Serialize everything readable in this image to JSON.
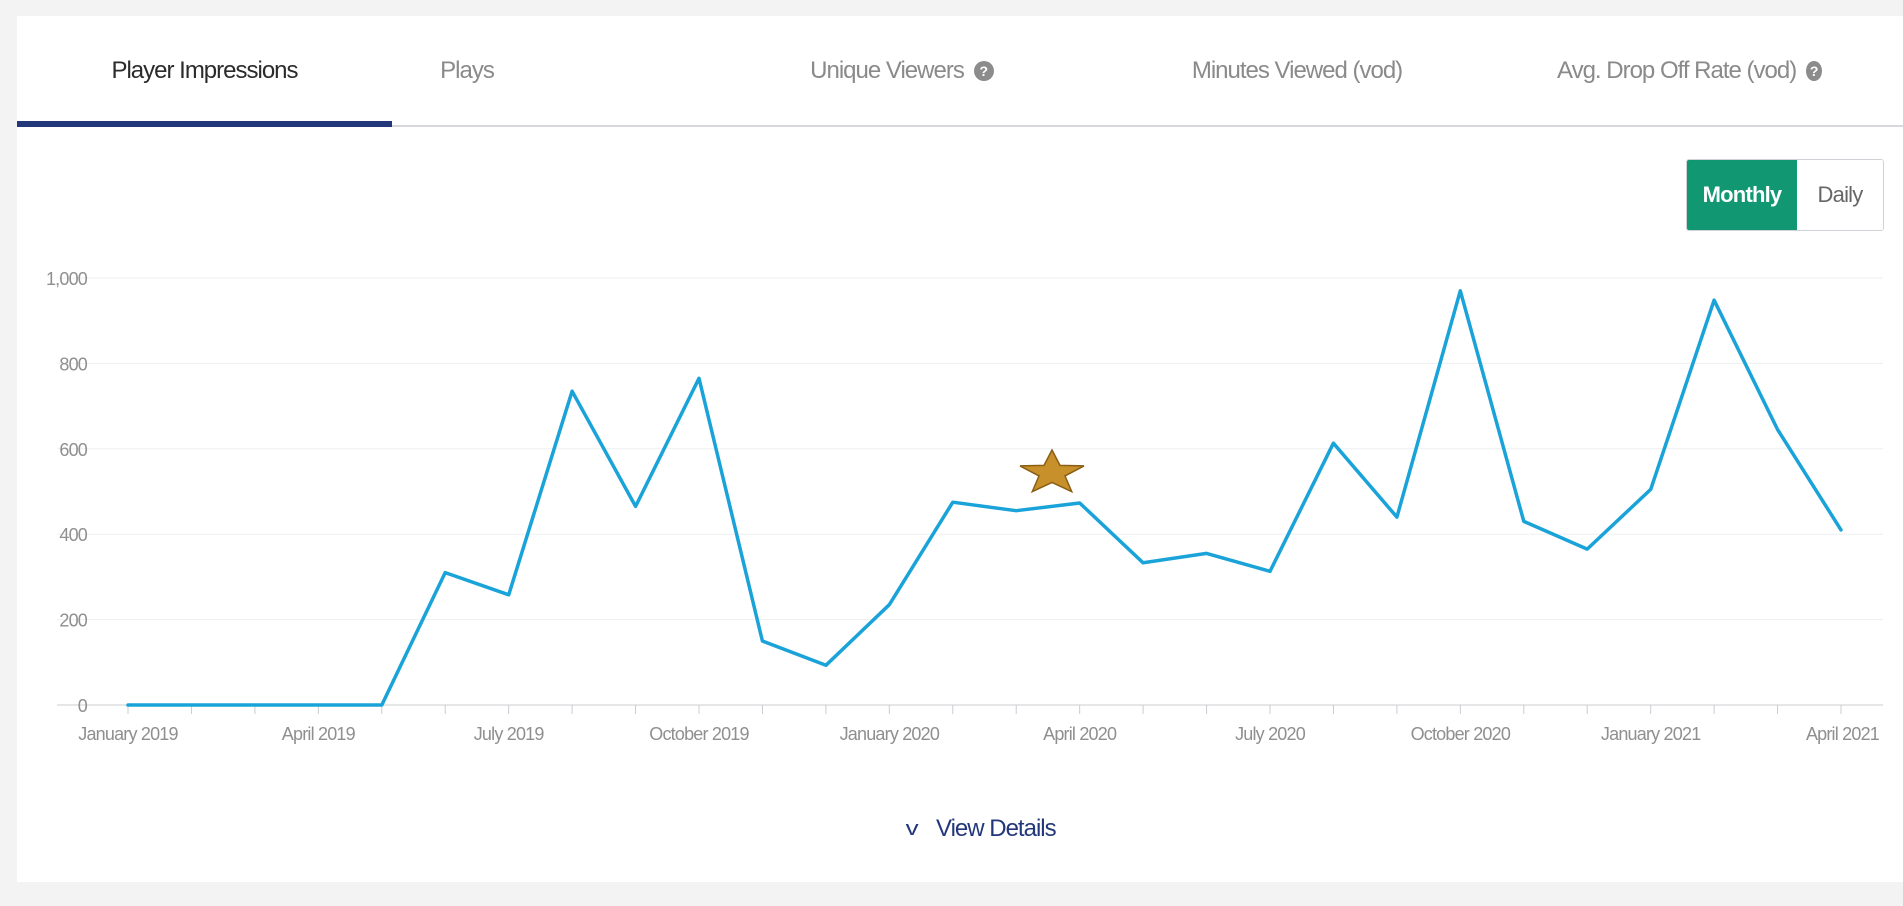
{
  "tabs": [
    {
      "label": "Player Impressions",
      "active": true,
      "help": false
    },
    {
      "label": "Plays",
      "active": false,
      "help": false
    },
    {
      "label": "Unique Viewers",
      "active": false,
      "help": true
    },
    {
      "label": "Minutes Viewed (vod)",
      "active": false,
      "help": false
    },
    {
      "label": "Avg. Drop Off Rate (vod)",
      "active": false,
      "help": true
    }
  ],
  "help_icon_glyph": "?",
  "toggle": {
    "monthly_label": "Monthly",
    "daily_label": "Daily",
    "selected": "Monthly"
  },
  "view_details": {
    "chevron": "v",
    "label": "View Details"
  },
  "marker": {
    "icon": "star-icon",
    "color": "#c8902a"
  },
  "chart_data": {
    "type": "line",
    "title": "",
    "xlabel": "",
    "ylabel": "",
    "ylim": [
      0,
      1000
    ],
    "yticks": [
      "0",
      "200",
      "400",
      "600",
      "800",
      "1,000"
    ],
    "xticks": [
      "January 2019",
      "April 2019",
      "July 2019",
      "October 2019",
      "January 2020",
      "April 2020",
      "July 2020",
      "October 2020",
      "January 2021",
      "April 2021"
    ],
    "x": [
      "January 2019",
      "February 2019",
      "March 2019",
      "April 2019",
      "May 2019",
      "June 2019",
      "July 2019",
      "August 2019",
      "September 2019",
      "October 2019",
      "November 2019",
      "December 2019",
      "January 2020",
      "February 2020",
      "March 2020",
      "April 2020",
      "May 2020",
      "June 2020",
      "July 2020",
      "August 2020",
      "September 2020",
      "October 2020",
      "November 2020",
      "December 2020",
      "January 2021",
      "February 2021",
      "March 2021",
      "April 2021"
    ],
    "values": [
      0,
      0,
      0,
      0,
      0,
      310,
      258,
      735,
      465,
      765,
      150,
      93,
      235,
      475,
      455,
      473,
      333,
      355,
      313,
      613,
      440,
      970,
      430,
      365,
      505,
      948,
      645,
      410
    ],
    "line_color": "#1aa3d9",
    "grid": true
  }
}
